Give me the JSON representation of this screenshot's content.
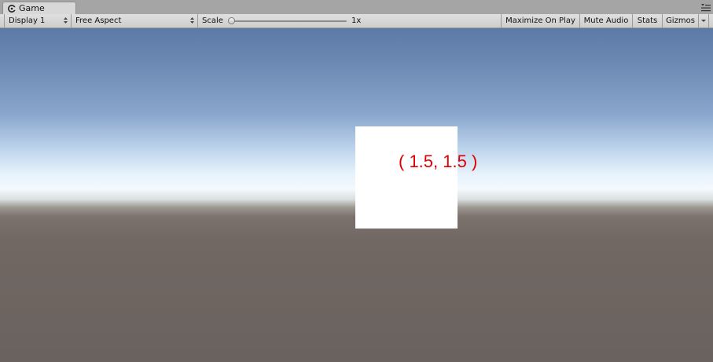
{
  "tab": {
    "title": "Game",
    "icon": "game-controller-icon"
  },
  "toolbar": {
    "display_label": "Display 1",
    "aspect_label": "Free Aspect",
    "scale_label": "Scale",
    "scale_value": "1x",
    "scale_level": 0,
    "maximize_label": "Maximize On Play",
    "mute_label": "Mute Audio",
    "stats_label": "Stats",
    "gizmos_label": "Gizmos"
  },
  "viewport": {
    "label_text": "( 1.5, 1.5 )",
    "label_color": "#e00000",
    "cube_color": "#ffffff",
    "sky_color": "#5c7aa6",
    "ground_color": "#6a625e"
  }
}
